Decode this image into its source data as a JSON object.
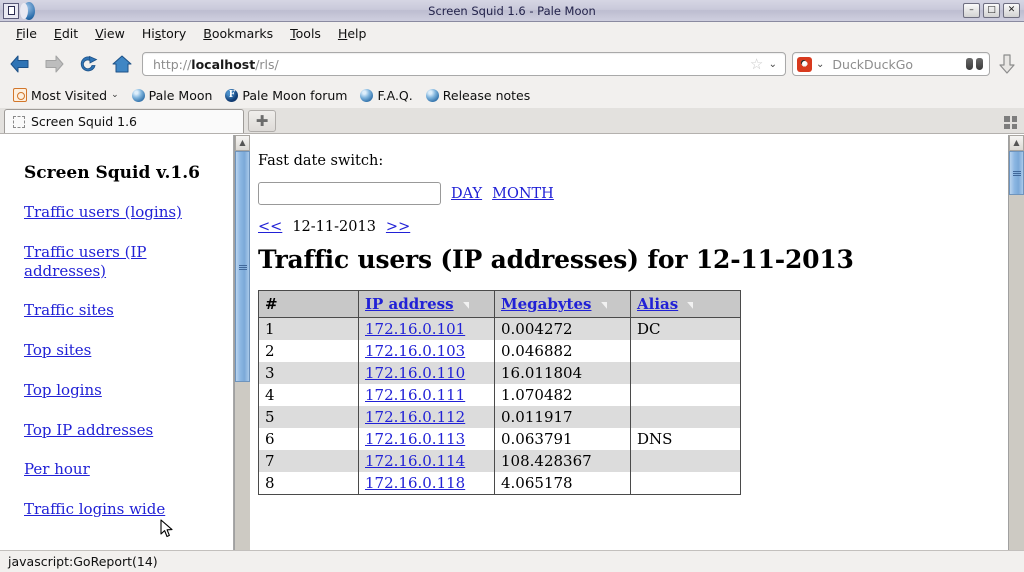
{
  "window": {
    "title": "Screen Squid 1.6 - Pale Moon",
    "minimize_label": "–",
    "maximize_label": "□",
    "close_label": "✕"
  },
  "menubar": {
    "items": [
      {
        "label": "File",
        "accel": "F"
      },
      {
        "label": "Edit",
        "accel": "E"
      },
      {
        "label": "View",
        "accel": "V"
      },
      {
        "label": "History",
        "accel": "s"
      },
      {
        "label": "Bookmarks",
        "accel": "B"
      },
      {
        "label": "Tools",
        "accel": "T"
      },
      {
        "label": "Help",
        "accel": "H"
      }
    ]
  },
  "toolbar": {
    "back_title": "Back",
    "forward_title": "Forward",
    "reload_title": "Reload",
    "home_title": "Home",
    "url_prefix": "http://",
    "url_host": "localhost",
    "url_path": "/rls/",
    "url_full": "http://localhost/rls/",
    "bookmark_star": "☆",
    "url_dropdown": "⌄",
    "search_engine": "DuckDuckGo",
    "search_dropdown": "⌄",
    "search_go_title": "Search",
    "download_title": "Downloads"
  },
  "bookmarks": {
    "items": [
      {
        "label": "Most Visited",
        "icon": "most-visited-icon",
        "has_chevron": true
      },
      {
        "label": "Pale Moon",
        "icon": "globe-icon",
        "has_chevron": false
      },
      {
        "label": "Pale Moon forum",
        "icon": "forum-icon",
        "badge": "F",
        "has_chevron": false
      },
      {
        "label": "F.A.Q.",
        "icon": "globe-icon",
        "has_chevron": false
      },
      {
        "label": "Release notes",
        "icon": "globe-icon",
        "has_chevron": false
      }
    ],
    "chevron": "⌄"
  },
  "tabs": {
    "items": [
      {
        "label": "Screen Squid 1.6"
      }
    ],
    "new_tab_label": "✚"
  },
  "sidebar": {
    "title": "Screen Squid v.1.6",
    "items": [
      {
        "label": "Traffic users (logins)"
      },
      {
        "label": "Traffic users (IP addresses)"
      },
      {
        "label": "Traffic sites"
      },
      {
        "label": "Top sites"
      },
      {
        "label": "Top logins"
      },
      {
        "label": "Top IP addresses"
      },
      {
        "label": "Per hour"
      },
      {
        "label": "Traffic logins wide"
      }
    ]
  },
  "main": {
    "fast_date_label": "Fast date switch:",
    "date_input_value": "",
    "date_input_placeholder": "",
    "day_link": "DAY",
    "month_link": "MONTH",
    "prev_link": "<<",
    "next_link": ">>",
    "current_date": "12-11-2013",
    "heading": "Traffic users (IP addresses) for 12-11-2013",
    "table": {
      "columns": [
        {
          "label": "#",
          "sortable": false
        },
        {
          "label": "IP address",
          "sortable": true
        },
        {
          "label": "Megabytes",
          "sortable": true
        },
        {
          "label": "Alias",
          "sortable": true
        }
      ],
      "rows": [
        {
          "num": "1",
          "ip": "172.16.0.101",
          "megabytes": "0.004272",
          "alias": "DC"
        },
        {
          "num": "2",
          "ip": "172.16.0.103",
          "megabytes": "0.046882",
          "alias": ""
        },
        {
          "num": "3",
          "ip": "172.16.0.110",
          "megabytes": "16.011804",
          "alias": ""
        },
        {
          "num": "4",
          "ip": "172.16.0.111",
          "megabytes": "1.070482",
          "alias": ""
        },
        {
          "num": "5",
          "ip": "172.16.0.112",
          "megabytes": "0.011917",
          "alias": ""
        },
        {
          "num": "6",
          "ip": "172.16.0.113",
          "megabytes": "0.063791",
          "alias": "DNS"
        },
        {
          "num": "7",
          "ip": "172.16.0.114",
          "megabytes": "108.428367",
          "alias": ""
        },
        {
          "num": "8",
          "ip": "172.16.0.118",
          "megabytes": "4.065178",
          "alias": ""
        }
      ]
    }
  },
  "statusbar": {
    "text": "javascript:GoReport(14)"
  },
  "colors": {
    "link": "#2121d6",
    "table_header_bg": "#c8c8c8",
    "row_odd_bg": "#dcdcdc",
    "row_even_bg": "#ffffff",
    "chrome_bg": "#f2f0ee",
    "titlebar_bg": "#c9c9da"
  }
}
